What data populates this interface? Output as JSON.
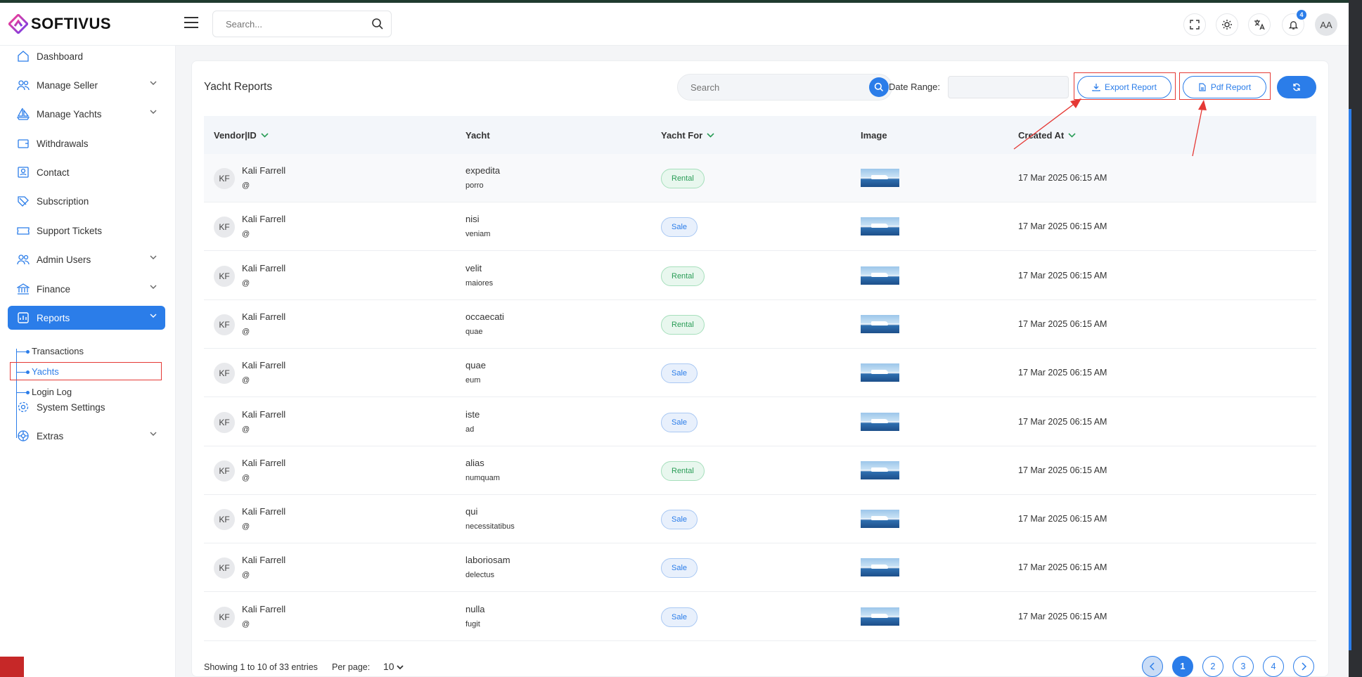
{
  "brand": {
    "name": "SOFTIVUS"
  },
  "header": {
    "search_placeholder": "Search...",
    "notification_count": "4",
    "avatar_initials": "AA"
  },
  "sidebar": {
    "items": [
      {
        "label": "Dashboard",
        "icon": "home-icon"
      },
      {
        "label": "Manage Seller",
        "icon": "users-icon",
        "has_children": true
      },
      {
        "label": "Manage Yachts",
        "icon": "sailboat-icon",
        "has_children": true
      },
      {
        "label": "Withdrawals",
        "icon": "wallet-icon"
      },
      {
        "label": "Contact",
        "icon": "contact-icon"
      },
      {
        "label": "Subscription",
        "icon": "subscription-icon"
      },
      {
        "label": "Support Tickets",
        "icon": "ticket-icon"
      },
      {
        "label": "Admin Users",
        "icon": "admin-users-icon",
        "has_children": true
      },
      {
        "label": "Finance",
        "icon": "bank-icon",
        "has_children": true
      },
      {
        "label": "Reports",
        "icon": "report-icon",
        "has_children": true,
        "active": true
      },
      {
        "label": "System Settings",
        "icon": "gear-icon"
      },
      {
        "label": "Extras",
        "icon": "extras-icon",
        "has_children": true
      }
    ],
    "reports_children": [
      {
        "label": "Transactions"
      },
      {
        "label": "Yachts",
        "active": true
      },
      {
        "label": "Login Log"
      }
    ]
  },
  "page": {
    "title": "Yacht Reports",
    "search_placeholder": "Search",
    "date_range_label": "Date Range:",
    "export_label": "Export Report",
    "pdf_label": "Pdf Report"
  },
  "table": {
    "columns": [
      "Vendor|ID",
      "Yacht",
      "Yacht For",
      "Image",
      "Created At"
    ],
    "rows": [
      {
        "initials": "KF",
        "vendor": "Kali Farrell",
        "id": "@",
        "yacht": "expedita",
        "yacht_sub": "porro",
        "for": "Rental",
        "created": "17 Mar 2025 06:15 AM"
      },
      {
        "initials": "KF",
        "vendor": "Kali Farrell",
        "id": "@",
        "yacht": "nisi",
        "yacht_sub": "veniam",
        "for": "Sale",
        "created": "17 Mar 2025 06:15 AM"
      },
      {
        "initials": "KF",
        "vendor": "Kali Farrell",
        "id": "@",
        "yacht": "velit",
        "yacht_sub": "maiores",
        "for": "Rental",
        "created": "17 Mar 2025 06:15 AM"
      },
      {
        "initials": "KF",
        "vendor": "Kali Farrell",
        "id": "@",
        "yacht": "occaecati",
        "yacht_sub": "quae",
        "for": "Rental",
        "created": "17 Mar 2025 06:15 AM"
      },
      {
        "initials": "KF",
        "vendor": "Kali Farrell",
        "id": "@",
        "yacht": "quae",
        "yacht_sub": "eum",
        "for": "Sale",
        "created": "17 Mar 2025 06:15 AM"
      },
      {
        "initials": "KF",
        "vendor": "Kali Farrell",
        "id": "@",
        "yacht": "iste",
        "yacht_sub": "ad",
        "for": "Sale",
        "created": "17 Mar 2025 06:15 AM"
      },
      {
        "initials": "KF",
        "vendor": "Kali Farrell",
        "id": "@",
        "yacht": "alias",
        "yacht_sub": "numquam",
        "for": "Rental",
        "created": "17 Mar 2025 06:15 AM"
      },
      {
        "initials": "KF",
        "vendor": "Kali Farrell",
        "id": "@",
        "yacht": "qui",
        "yacht_sub": "necessitatibus",
        "for": "Sale",
        "created": "17 Mar 2025 06:15 AM"
      },
      {
        "initials": "KF",
        "vendor": "Kali Farrell",
        "id": "@",
        "yacht": "laboriosam",
        "yacht_sub": "delectus",
        "for": "Sale",
        "created": "17 Mar 2025 06:15 AM"
      },
      {
        "initials": "KF",
        "vendor": "Kali Farrell",
        "id": "@",
        "yacht": "nulla",
        "yacht_sub": "fugit",
        "for": "Sale",
        "created": "17 Mar 2025 06:15 AM"
      }
    ]
  },
  "footer": {
    "showing": "Showing 1 to 10 of 33 entries",
    "per_page_label": "Per page:",
    "per_page_value": "10",
    "pages": [
      "1",
      "2",
      "3",
      "4"
    ],
    "current_page": "1"
  },
  "colors": {
    "accent": "#2b7de9",
    "rental": "#2a9d57",
    "highlight": "#e53935"
  }
}
